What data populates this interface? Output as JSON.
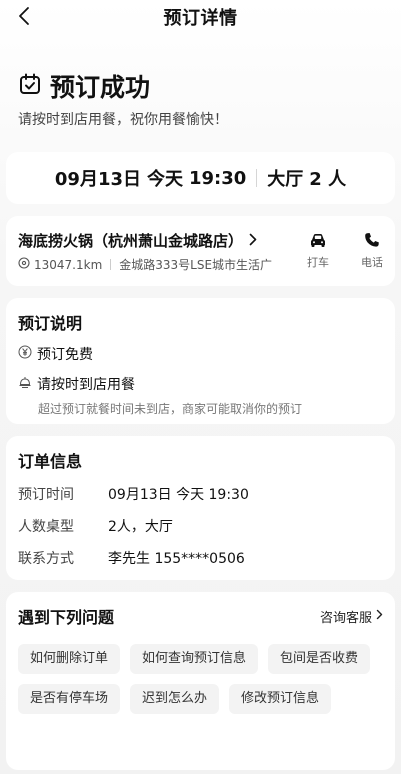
{
  "header": {
    "title": "预订详情"
  },
  "hero": {
    "title": "预订成功",
    "subtitle": "请按时到店用餐，祝你用餐愉快！"
  },
  "booking": {
    "date": "09月13日",
    "day": "今天",
    "time": "19:30",
    "area": "大厅",
    "party": "2 人"
  },
  "restaurant": {
    "name": "海底捞火锅（杭州萧山金城路店）",
    "distance": "13047.1km",
    "address": "金城路333号LSE城市生活广",
    "taxi_label": "打车",
    "phone_label": "电话"
  },
  "notes": {
    "title": "预订说明",
    "free": "预订免费",
    "ontime": "请按时到店用餐",
    "ontime_desc": "超过预订就餐时间未到店，商家可能取消你的预订"
  },
  "order": {
    "title": "订单信息",
    "rows": [
      {
        "label": "预订时间",
        "value": "09月13日 今天 19:30"
      },
      {
        "label": "人数桌型",
        "value": "2人，大厅"
      },
      {
        "label": "联系方式",
        "value": "李先生 155****0506"
      }
    ]
  },
  "faq": {
    "title": "遇到下列问题",
    "link": "咨询客服",
    "chips": [
      "如何删除订单",
      "如何查询预订信息",
      "包间是否收费",
      "是否有停车场",
      "迟到怎么办",
      "修改预订信息"
    ]
  }
}
